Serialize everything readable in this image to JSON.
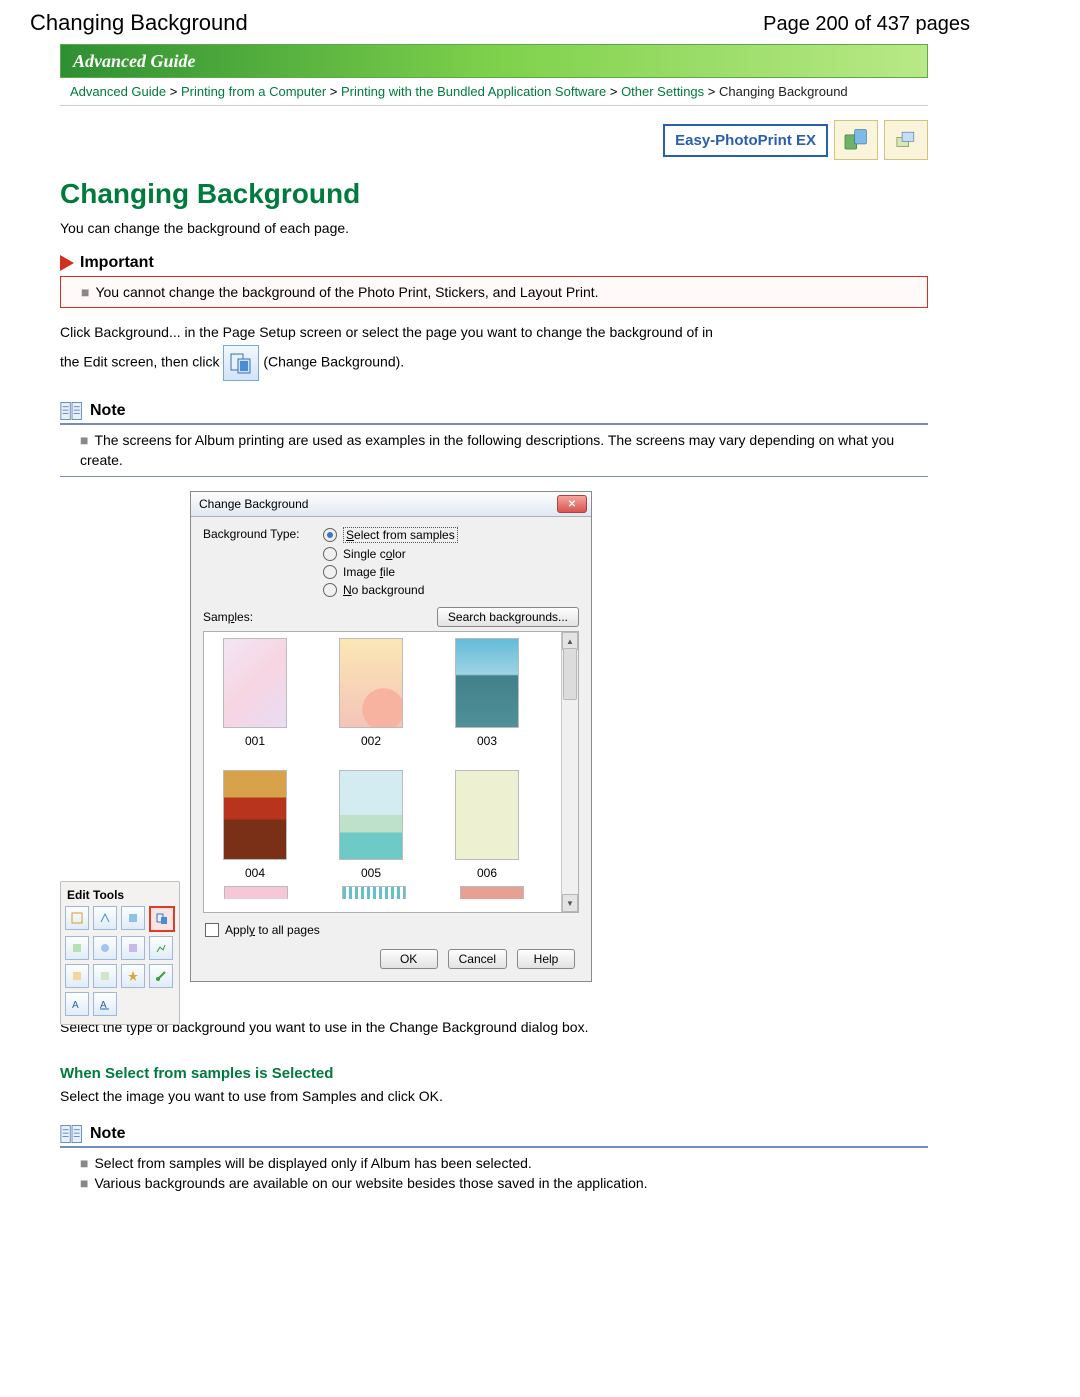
{
  "header": {
    "title_left": "Changing Background",
    "title_right": "Page 200 of 437 pages",
    "guide_bar": "Advanced Guide"
  },
  "breadcrumb": {
    "advanced_guide": "Advanced Guide",
    "printing_from_computer": "Printing from a Computer",
    "printing_bundled": "Printing with the Bundled Application Software",
    "other_settings": "Other Settings",
    "current": "Changing Background",
    "sep": " > "
  },
  "badges": {
    "easy_photoprint": "Easy-PhotoPrint EX"
  },
  "main": {
    "title": "Changing Background",
    "intro": "You can change the background of each page.",
    "important_label": "Important",
    "important_body": "You cannot change the background of the Photo Print, Stickers, and Layout Print.",
    "instr": {
      "part1": "Click Background... in the Page Setup screen or select the page you want to change the background of in",
      "part2a": "the Edit screen, then click ",
      "part2b": " (Change Background).",
      "page_underline": "Pag"
    },
    "note_label": "Note",
    "note_body": "The screens for Album printing are used as examples in the following descriptions. The screens may vary depending on what you create.",
    "after_dialog": "Select the type of background you want to use in the Change Background dialog box.",
    "when_select_title": "When Select from samples is Selected",
    "when_select_body": "Select the image you want to use from Samples and click OK.",
    "note2_a": "Select from samples will be displayed only if Album has been selected.",
    "note2_b": "Various backgrounds are available on our website besides those saved in the application."
  },
  "edit_tools": {
    "title": "Edit Tools"
  },
  "dialog": {
    "title": "Change Background",
    "bg_type_label": "Background Type:",
    "opt_samples_pre": "S",
    "opt_samples_rest": "elect from samples",
    "opt_single_pre": "Single c",
    "opt_single_u": "o",
    "opt_single_post": "lor",
    "opt_image_pre": "Image ",
    "opt_image_u": "f",
    "opt_image_post": "ile",
    "opt_none_u": "N",
    "opt_none_post": "o background",
    "samples_pre": "Sam",
    "samples_u": "p",
    "samples_post": "les:",
    "search_btn": "Search backgrounds...",
    "thumbs": {
      "a": "001",
      "b": "002",
      "c": "003",
      "d": "004",
      "e": "005",
      "f": "006"
    },
    "apply_pre": "Appl",
    "apply_u": "y",
    "apply_post": " to all pages",
    "ok": "OK",
    "cancel": "Cancel",
    "help": "Help"
  }
}
